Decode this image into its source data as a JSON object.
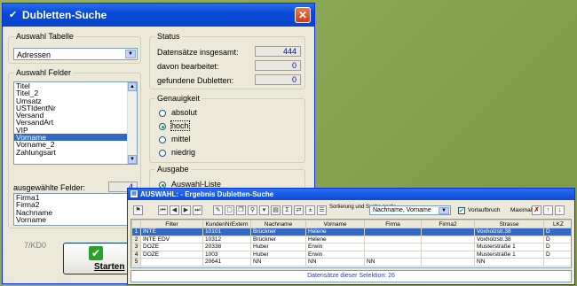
{
  "main_window": {
    "title": "Dubletten-Suche",
    "title_icon": "check-icon",
    "close_glyph": "✕",
    "auswahl_tabelle": {
      "legend": "Auswahl Tabelle",
      "value": "Adressen"
    },
    "auswahl_felder": {
      "legend": "Auswahl Felder",
      "items": [
        "Titel",
        "Titel_2",
        "Umsatz",
        "USTIdentNr",
        "Versand",
        "VersandArt",
        "VIP",
        "Vorname",
        "Vorname_2",
        "Zahlungsart"
      ],
      "selected_index": 7,
      "selected_label": "ausgewählte Felder:",
      "selected_count": "4",
      "selected_items": [
        "Firma1",
        "Firma2",
        "Nachname",
        "Vorname"
      ]
    },
    "status": {
      "legend": "Status",
      "rows": [
        {
          "label": "Datensätze insgesamt:",
          "value": "444"
        },
        {
          "label": "davon bearbeitet:",
          "value": "0"
        },
        {
          "label": "gefundene Dubletten:",
          "value": "0"
        }
      ]
    },
    "genauigkeit": {
      "legend": "Genauigkeit",
      "options": [
        "absolut",
        "hoch",
        "mittel",
        "niedrig"
      ],
      "selected_index": 1
    },
    "ausgabe": {
      "legend": "Ausgabe",
      "option": "Auswahl-Liste"
    },
    "bottom_label": "7/KD0",
    "start_button": "Starten"
  },
  "sub_window": {
    "title": "AUSWAHL:  - Ergebnis Dubletten-Suche",
    "sort_label": "Sortierung und Suche nach:",
    "sort_value": "Nachname, Vorname",
    "vorlaufbruch_label": "Vorlaufbruch",
    "maximal_label": "Maximal",
    "columns": [
      "",
      "Filter",
      "KundenNrExtern",
      "Nachname",
      "Vorname",
      "Firma",
      "Firma2",
      "Strasse",
      "LKZ"
    ],
    "rows": [
      {
        "n": "1",
        "filter": "INTE",
        "kd": "10101",
        "nachname": "Brückner",
        "vorname": "Helene",
        "firma": "",
        "firma2": "",
        "strasse": "Voxholzstr.38",
        "lkz": "D"
      },
      {
        "n": "2",
        "filter": "INTE EDV",
        "kd": "10312",
        "nachname": "Brückner",
        "vorname": "Helene",
        "firma": "",
        "firma2": "",
        "strasse": "Voxholzstr.38",
        "lkz": "D"
      },
      {
        "n": "3",
        "filter": "DOZE",
        "kd": "20338",
        "nachname": "Huber",
        "vorname": "Erwin",
        "firma": "",
        "firma2": "",
        "strasse": "Musterstraße 1",
        "lkz": "D"
      },
      {
        "n": "4",
        "filter": "DOZE",
        "kd": "1003",
        "nachname": "Huber",
        "vorname": "Erwin",
        "firma": "",
        "firma2": "",
        "strasse": "Musterstraße 1",
        "lkz": "D"
      },
      {
        "n": "5",
        "filter": "",
        "kd": "20641",
        "nachname": "NN",
        "vorname": "NN",
        "firma": "NN",
        "firma2": "",
        "strasse": "NN",
        "lkz": ""
      }
    ],
    "selected_row": 0,
    "footer": "Datensätze dieser Selektion: 26"
  }
}
